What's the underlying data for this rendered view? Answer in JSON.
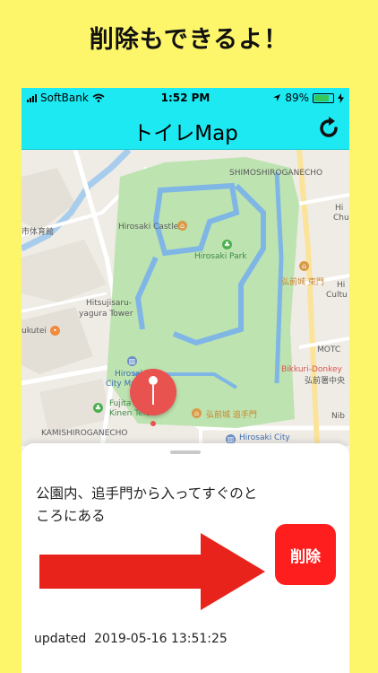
{
  "promo": {
    "headline": "削除もできるよ！"
  },
  "statusbar": {
    "carrier": "SoftBank",
    "time": "1:52 PM",
    "battery": "89%",
    "battery_level": 0.89,
    "icons": [
      "signal-icon",
      "wifi-icon",
      "location-arrow-icon",
      "battery-icon",
      "charging-icon"
    ]
  },
  "navbar": {
    "title": "トイレMap",
    "refresh_icon": "refresh-icon"
  },
  "map": {
    "labels": {
      "shimoshiroganecho": "SHIMOSHIROGANECHO",
      "hirosaki_castle": "Hirosaki Castle",
      "hirosaki_park": "Hirosaki Park",
      "hirosaki_castle_east_gate": "弘前城 東門",
      "hitsujisaru_1": "Hitsujisaru-",
      "hitsujisaru_2": "yagura Tower",
      "hirosaki_city_museum_1": "Hirosaki",
      "hirosaki_city_museum_2": "City Museum",
      "fujita_1": "Fujita",
      "fujita_2": "Kinen Teien",
      "otemon": "弘前城 追手門",
      "kamishiroganecho": "KAMISHIROGANECHO",
      "hirosaki_city": "Hirosaki City",
      "bikkuri_donkey": "Bikkuri-Donkey",
      "hirosaki_police": "弘前署中央",
      "motc": "MOTC",
      "hi_chu": "Hi",
      "chu": "Chu",
      "hi_cultu": "Hi",
      "cultu": "Cultu",
      "taiikukan": "市体育館",
      "kukutei": "ukutei",
      "nib": "Nib"
    }
  },
  "detail": {
    "description": "公園内、追手門から入ってすぐのところにある",
    "delete_label": "削除",
    "updated_label": "updated",
    "updated_value": "2019-05-16 13:51:25"
  },
  "colors": {
    "background": "#fdf56a",
    "navbar": "#1de9f2",
    "pin": "#e8524f",
    "arrow": "#e8231b",
    "delete_button": "#ff1e1e",
    "park": "#bde3b0",
    "moat": "#7fb6e6"
  }
}
